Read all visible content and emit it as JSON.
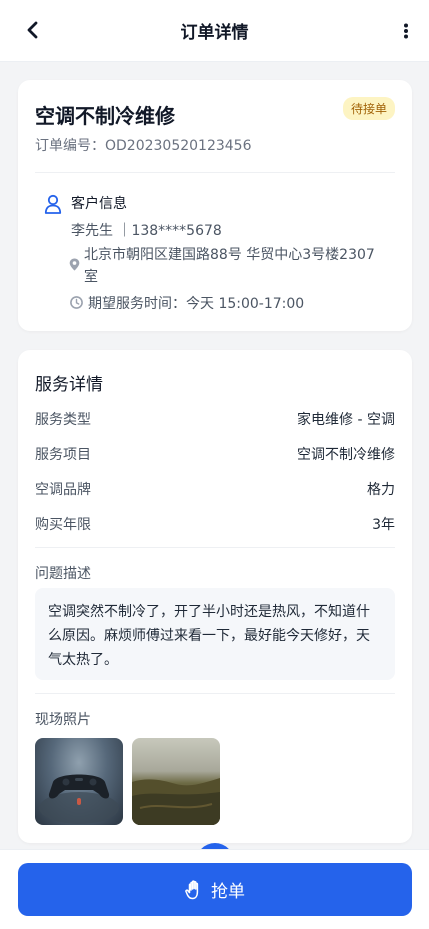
{
  "header": {
    "title": "订单详情",
    "back_icon": "chevron-left-icon",
    "more_icon": "more-vertical-icon"
  },
  "order": {
    "title": "空调不制冷维修",
    "status": "待接单",
    "number": "订单编号：OD20230520123456",
    "status_color": "#a16207",
    "status_bg": "#fdf4c3"
  },
  "customer": {
    "header": "客户信息",
    "name_phone": "李先生 ｜138****5678",
    "address": "北京市朝阳区建国路88号 华贸中心3号楼2307室",
    "time": "期望服务时间：今天 15:00-17:00"
  },
  "service": {
    "title": "服务详情",
    "rows": [
      {
        "label": "服务类型",
        "value": "家电维修 - 空调"
      },
      {
        "label": "服务项目",
        "value": "空调不制冷维修"
      },
      {
        "label": "空调品牌",
        "value": "格力"
      },
      {
        "label": "购买年限",
        "value": "3年"
      }
    ],
    "problem_label": "问题描述",
    "problem_text": "空调突然不制冷了，开了半小时还是热风，不知道什么原因。麻烦师傅过来看一下，最好能今天修好，天气太热了。",
    "photos_label": "现场照片"
  },
  "action": {
    "grab_label": "抢单",
    "grab_icon": "hand-icon",
    "accent": "#2563eb"
  }
}
